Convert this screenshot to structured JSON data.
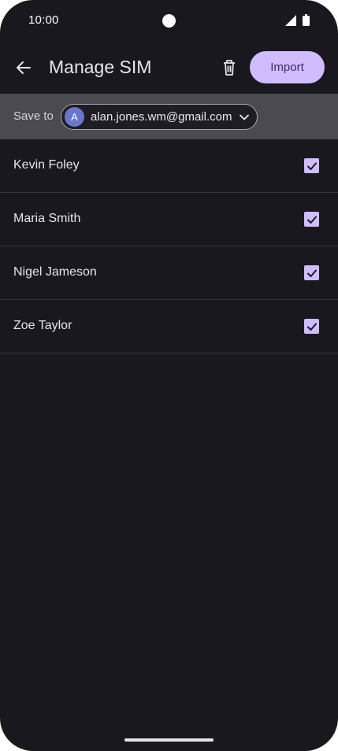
{
  "status_bar": {
    "time": "10:00"
  },
  "app_bar": {
    "title": "Manage SIM",
    "import_label": "Import"
  },
  "save_to": {
    "label": "Save to",
    "avatar_initial": "A",
    "account_email": "alan.jones.wm@gmail.com"
  },
  "contacts": [
    {
      "name": "Kevin Foley",
      "checked": true
    },
    {
      "name": "Maria Smith",
      "checked": true
    },
    {
      "name": "Nigel Jameson",
      "checked": true
    },
    {
      "name": "Zoe Taylor",
      "checked": true
    }
  ],
  "colors": {
    "background": "#1a181f",
    "accent": "#d0bcff",
    "save_bar": "#4b4a50",
    "avatar": "#6a76c9"
  }
}
